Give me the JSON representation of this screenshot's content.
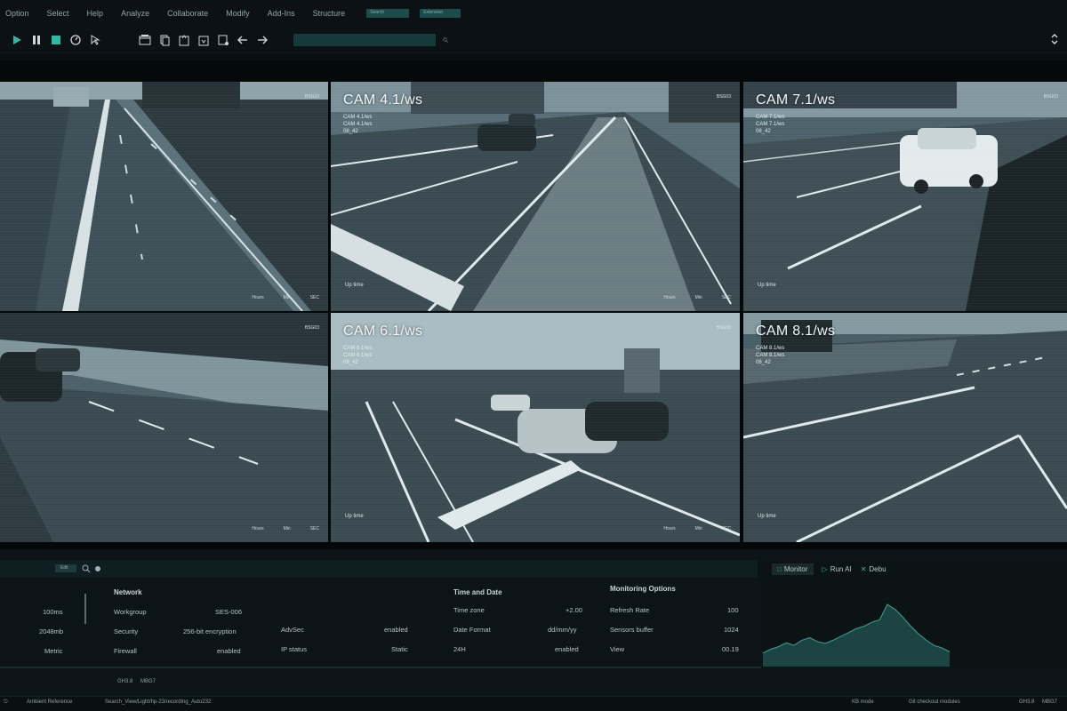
{
  "menu": {
    "items": [
      "Option",
      "Select",
      "Help",
      "Analyze",
      "Collaborate",
      "Modify",
      "Add-Ins",
      "Structure"
    ],
    "search_label": "Search",
    "extension_label": "Extension"
  },
  "toolbar": {
    "icons": [
      "play-icon",
      "pause-icon",
      "stop-icon",
      "timer-icon",
      "cursor-icon",
      "window-icon",
      "layers-icon",
      "export-icon",
      "import-icon",
      "save-icon",
      "arrow-left-icon",
      "arrow-right-icon"
    ]
  },
  "cameras": [
    {
      "title": "",
      "meta": [],
      "corner": "BSG03",
      "uptime": "",
      "stats": [
        "Hours",
        "Min",
        "SEC"
      ]
    },
    {
      "title": "CAM 4.1/ws",
      "meta": [
        "CAM 4.1/ws",
        "CAM 4.1/ws",
        "08_42"
      ],
      "corner": "BSG03",
      "uptime": "Up time",
      "stats": [
        "Hours",
        "Min",
        "SEC"
      ]
    },
    {
      "title": "CAM 7.1/ws",
      "meta": [
        "CAM 7.1/ws",
        "CAM 7.1/ws",
        "08_42"
      ],
      "corner": "BSG03",
      "uptime": "Up time",
      "stats": [
        "Hours",
        "Min",
        "SEC"
      ]
    },
    {
      "title": "",
      "meta": [],
      "corner": "BSG03",
      "uptime": "",
      "stats": [
        "Hours",
        "Min",
        "SEC"
      ]
    },
    {
      "title": "CAM 6.1/ws",
      "meta": [
        "CAM 6.1/ws",
        "CAM 6.1/ws",
        "08_42"
      ],
      "corner": "BSG03",
      "uptime": "Up time",
      "stats": [
        "Hours",
        "Min",
        "SEC"
      ]
    },
    {
      "title": "CAM 8.1/ws",
      "meta": [
        "CAM 8.1/ws",
        "CAM 8.1/ws",
        "08_42"
      ],
      "corner": "BSG03",
      "uptime": "Up time",
      "stats": [
        "Hours",
        "Min",
        "SEC"
      ]
    }
  ],
  "panel": {
    "tab_chip": "Edit",
    "left_values": [
      {
        "value": "100ms"
      },
      {
        "value": "2048mb"
      },
      {
        "value": "Metric"
      }
    ],
    "network": {
      "heading": "Network",
      "rows": [
        {
          "label": "Workgroup",
          "value": "SES-006"
        },
        {
          "label": "Security",
          "value": "256-bit encryption"
        },
        {
          "label": "Firewall",
          "value": "enabled"
        }
      ]
    },
    "misc": {
      "rows": [
        {
          "label": "AdvSec",
          "value": "enabled"
        },
        {
          "label": "IP status",
          "value": "Static"
        }
      ]
    },
    "time_date": {
      "heading": "Time and Date",
      "rows": [
        {
          "label": "Time zone",
          "value": "+2.00"
        },
        {
          "label": "Date Format",
          "value": "dd/mm/yy"
        },
        {
          "label": "24H",
          "value": "enabled"
        }
      ]
    },
    "monitoring": {
      "heading": "Monitoring Options",
      "rows": [
        {
          "label": "Refresh Rate",
          "value": "100"
        },
        {
          "label": "Sensors buffer",
          "value": "1024"
        },
        {
          "label": "View",
          "value": "00.19"
        }
      ]
    }
  },
  "right_panel": {
    "tabs": [
      {
        "label": "Monitor",
        "glyph": "□"
      },
      {
        "label": "Run AI",
        "glyph": "▷"
      },
      {
        "label": "Debu",
        "glyph": "✕"
      }
    ],
    "graph_values": [
      0.1,
      0.16,
      0.2,
      0.26,
      0.22,
      0.3,
      0.34,
      0.28,
      0.25,
      0.3,
      0.36,
      0.42,
      0.48,
      0.52,
      0.58,
      0.62,
      0.86,
      0.78,
      0.66,
      0.52,
      0.4,
      0.3,
      0.22,
      0.18,
      0.12
    ]
  },
  "status": {
    "reference": "Ambient Reference",
    "path": "Search_View/Light/hp-23/recording_Auto232",
    "mode_a": "GH3.8",
    "mode_b": "MBG7",
    "kb_mode": "KB mode",
    "checkout": "Git checkout modules",
    "right_a": "GH3.8",
    "right_b": "MBG7"
  },
  "colors": {
    "accent": "#2fb8a2",
    "input_bg": "#163a3a",
    "feed_tint": "#4e6670"
  }
}
